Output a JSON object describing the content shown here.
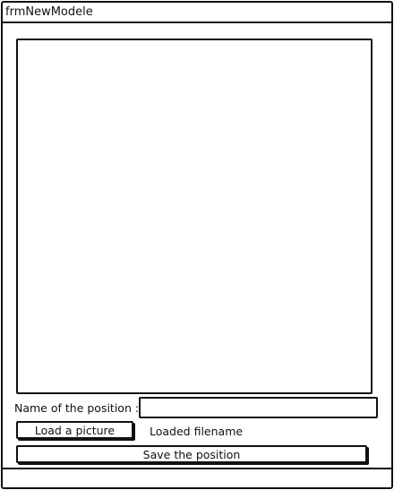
{
  "window": {
    "title": "frmNewModele"
  },
  "form": {
    "position_name_label": "Name of the position :",
    "position_name_value": "",
    "load_button_label": "Load a picture",
    "loaded_filename": "Loaded filename",
    "save_button_label": "Save the position"
  }
}
